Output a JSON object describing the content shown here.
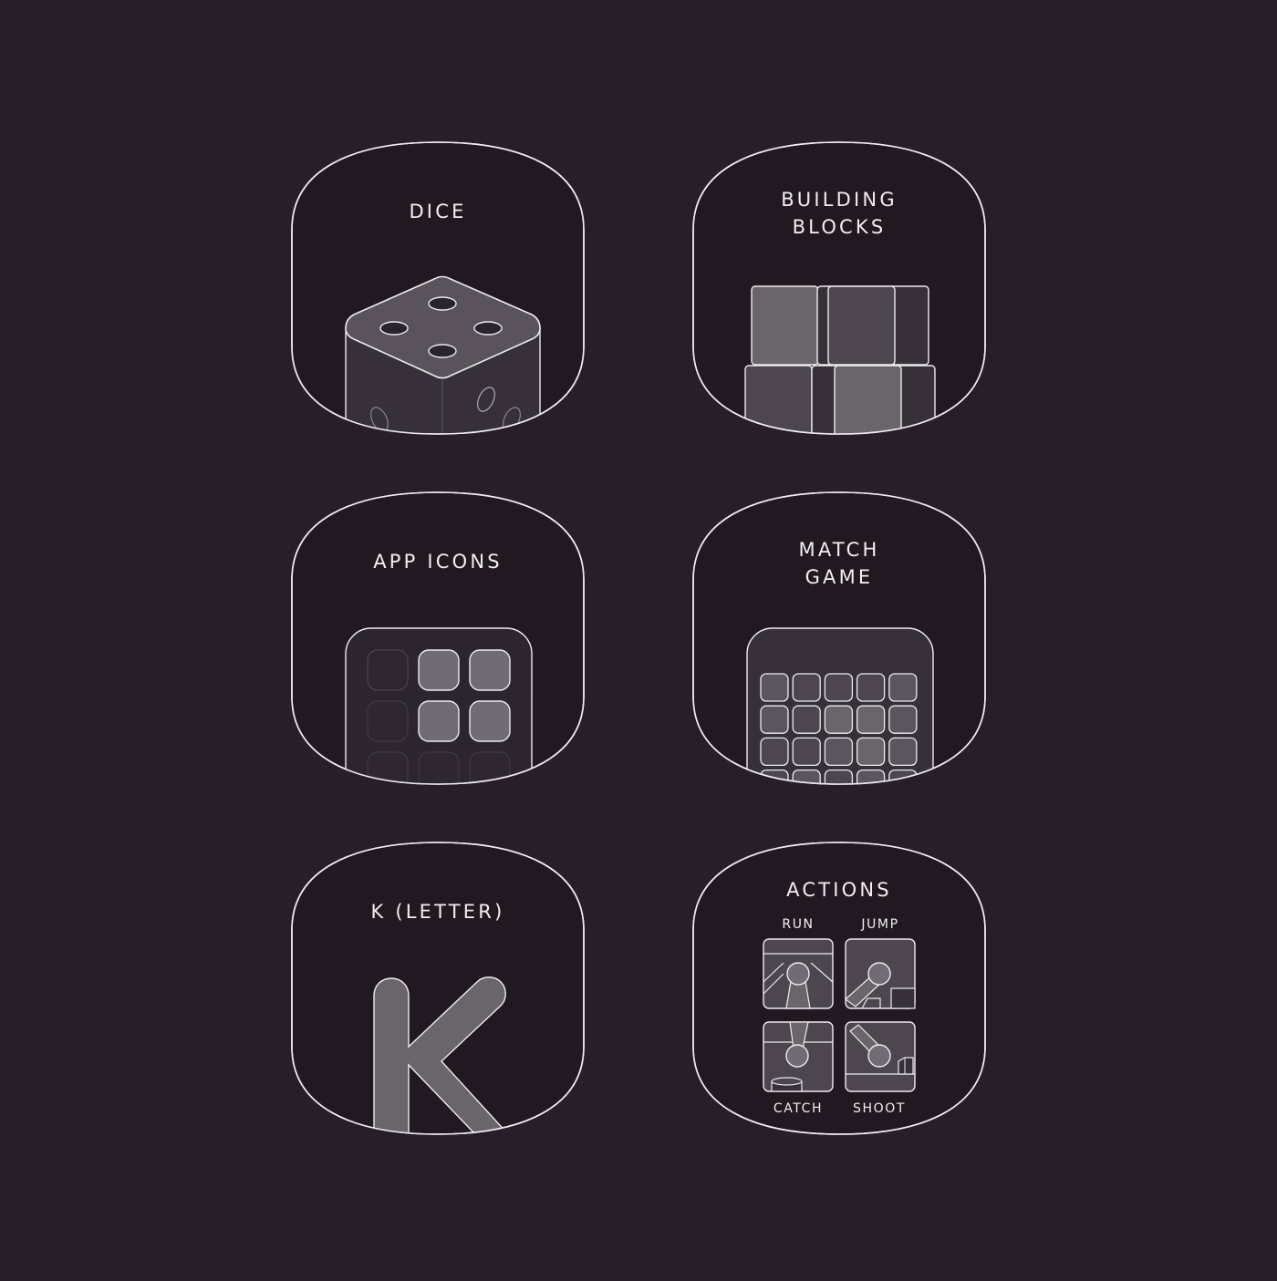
{
  "colors": {
    "background": "#271e2a",
    "tile_fill": "#211821",
    "outline": "#efeaf2",
    "text": "#f1eef4",
    "gray_light": "#6a646b",
    "gray_dark": "#4d464f",
    "gray_deep": "#373039"
  },
  "tiles": {
    "dice": {
      "title_lines": [
        "DICE"
      ],
      "icon": "dice-icon"
    },
    "building_blocks": {
      "title_lines": [
        "BUILDING",
        "BLOCKS"
      ],
      "icon": "building-blocks-icon"
    },
    "app_icons": {
      "title_lines": [
        "APP ICONS"
      ],
      "icon": "app-grid-icon"
    },
    "match_game": {
      "title_lines": [
        "MATCH",
        "GAME"
      ],
      "icon": "match-grid-icon"
    },
    "k_letter": {
      "title_lines": [
        "K (LETTER)"
      ],
      "icon": "letter-k-icon"
    },
    "actions": {
      "title_lines": [
        "ACTIONS"
      ],
      "icon": "actions-icon",
      "labels": {
        "run": "RUN",
        "jump": "JUMP",
        "catch": "CATCH",
        "shoot": "SHOOT"
      }
    }
  }
}
